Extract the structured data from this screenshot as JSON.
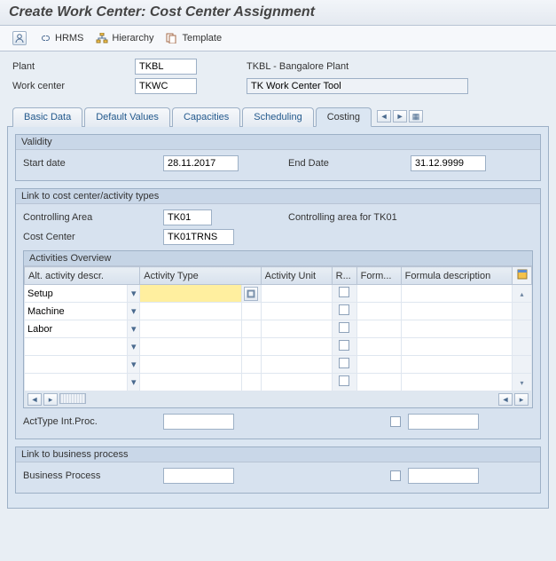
{
  "page_title": "Create Work Center: Cost Center Assignment",
  "toolbar": {
    "hrms_label": "HRMS",
    "hierarchy_label": "Hierarchy",
    "template_label": "Template"
  },
  "header": {
    "plant_label": "Plant",
    "plant_value": "TKBL",
    "plant_desc": "TKBL - Bangalore Plant",
    "work_center_label": "Work center",
    "work_center_value": "TKWC",
    "work_center_desc": "TK Work Center Tool"
  },
  "tabs": {
    "basic_data": "Basic Data",
    "default_values": "Default Values",
    "capacities": "Capacities",
    "scheduling": "Scheduling",
    "costing": "Costing"
  },
  "validity": {
    "group_title": "Validity",
    "start_label": "Start date",
    "start_value": "28.11.2017",
    "end_label": "End Date",
    "end_value": "31.12.9999"
  },
  "costcenter": {
    "group_title": "Link to cost center/activity types",
    "area_label": "Controlling Area",
    "area_value": "TK01",
    "area_desc": "Controlling area for TK01",
    "cc_label": "Cost Center",
    "cc_value": "TK01TRNS",
    "activities_title": "Activities Overview",
    "columns": {
      "alt_activity": "Alt. activity descr.",
      "activity_type": "Activity Type",
      "activity_unit": "Activity Unit",
      "r": "R...",
      "formula": "Form...",
      "formula_desc": "Formula description"
    },
    "rows": [
      {
        "alt": "Setup",
        "type": "",
        "unit": "",
        "r": false,
        "formula": "",
        "formula_desc": ""
      },
      {
        "alt": "Machine",
        "type": "",
        "unit": "",
        "r": false,
        "formula": "",
        "formula_desc": ""
      },
      {
        "alt": "Labor",
        "type": "",
        "unit": "",
        "r": false,
        "formula": "",
        "formula_desc": ""
      },
      {
        "alt": "",
        "type": "",
        "unit": "",
        "r": false,
        "formula": "",
        "formula_desc": ""
      },
      {
        "alt": "",
        "type": "",
        "unit": "",
        "r": false,
        "formula": "",
        "formula_desc": ""
      },
      {
        "alt": "",
        "type": "",
        "unit": "",
        "r": false,
        "formula": "",
        "formula_desc": ""
      }
    ],
    "acttype_label": "ActType Int.Proc.",
    "acttype_value": ""
  },
  "bp": {
    "group_title": "Link to business process",
    "bp_label": "Business Process",
    "bp_value": ""
  }
}
